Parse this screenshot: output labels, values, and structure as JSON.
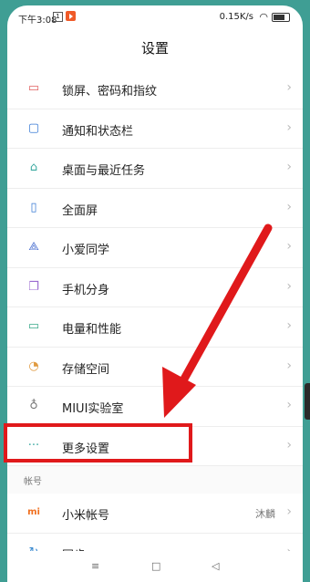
{
  "status": {
    "time": "下午3:08",
    "sim": "1",
    "network": "0.15K/s"
  },
  "page": {
    "title": "设置"
  },
  "items": [
    {
      "label": "锁屏、密码和指纹",
      "icon": "lock-icon"
    },
    {
      "label": "通知和状态栏",
      "icon": "notification-icon"
    },
    {
      "label": "桌面与最近任务",
      "icon": "home-icon"
    },
    {
      "label": "全面屏",
      "icon": "fullscreen-icon"
    },
    {
      "label": "小爱同学",
      "icon": "assistant-icon"
    },
    {
      "label": "手机分身",
      "icon": "dual-phone-icon"
    },
    {
      "label": "电量和性能",
      "icon": "battery-icon"
    },
    {
      "label": "存储空间",
      "icon": "storage-icon"
    },
    {
      "label": "MIUI实验室",
      "icon": "lab-flask-icon"
    },
    {
      "label": "更多设置",
      "icon": "more-dots-icon"
    }
  ],
  "section_account": {
    "label": "帐号"
  },
  "account_items": [
    {
      "label": "小米帐号",
      "value": "沐麟",
      "icon": "mi-logo-icon"
    },
    {
      "label": "同步",
      "icon": "sync-icon"
    }
  ],
  "nav": {
    "menu": "≡",
    "home": "□",
    "back": "◁"
  }
}
